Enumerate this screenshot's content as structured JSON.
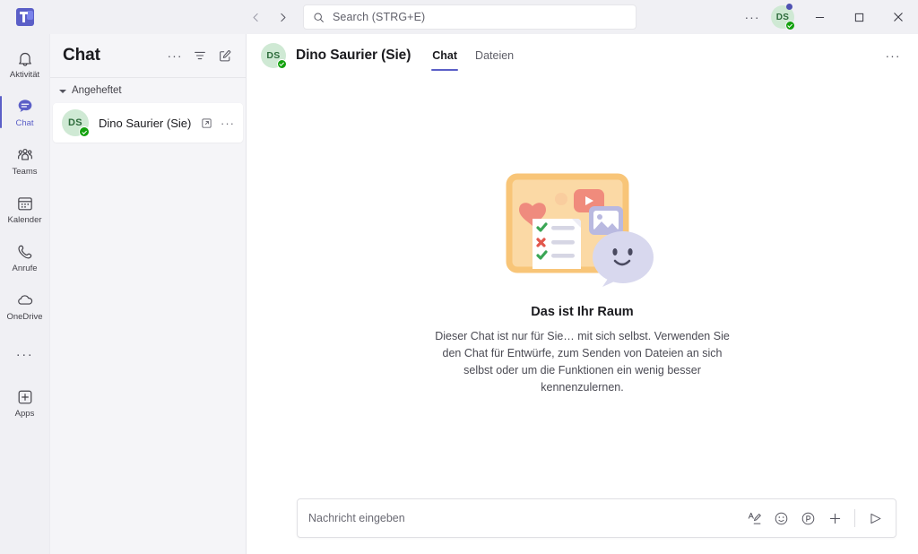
{
  "titlebar": {
    "logo_name": "teams-logo",
    "back_label": "‹",
    "forward_label": "›",
    "search_placeholder": "Search (STRG+E)",
    "more_label": "···",
    "avatar_initials": "DS",
    "minimize_label": "Minimieren",
    "maximize_label": "Maximieren",
    "close_label": "Schließen"
  },
  "rail": {
    "items": [
      {
        "label": "Aktivität",
        "icon": "bell-icon",
        "active": false
      },
      {
        "label": "Chat",
        "icon": "chat-bubble-icon",
        "active": true
      },
      {
        "label": "Teams",
        "icon": "people-icon",
        "active": false
      },
      {
        "label": "Kalender",
        "icon": "calendar-icon",
        "active": false
      },
      {
        "label": "Anrufe",
        "icon": "phone-icon",
        "active": false
      },
      {
        "label": "OneDrive",
        "icon": "cloud-icon",
        "active": false
      }
    ],
    "more_label": "···",
    "apps_label": "Apps"
  },
  "chatlist": {
    "title": "Chat",
    "more_label": "···",
    "filter_icon": "filter-icon",
    "compose_icon": "compose-icon",
    "section_label": "Angeheftet",
    "items": [
      {
        "name": "Dino Saurier (Sie)",
        "initials": "DS",
        "presence": "available",
        "popout_icon": "popout-icon",
        "more_label": "···"
      }
    ]
  },
  "chatheader": {
    "avatar_initials": "DS",
    "title": "Dino Saurier (Sie)",
    "tabs": [
      {
        "label": "Chat",
        "active": true
      },
      {
        "label": "Dateien",
        "active": false
      }
    ],
    "more_label": "···"
  },
  "empty_state": {
    "title": "Das ist Ihr Raum",
    "description": "Dieser Chat ist nur für Sie… mit sich selbst. Verwenden Sie den Chat für Entwürfe, zum Senden von Dateien an sich selbst oder um die Funktionen ein wenig besser kennenzulernen."
  },
  "composer": {
    "placeholder": "Nachricht eingeben",
    "actions": [
      {
        "name": "format-icon",
        "label": "Format"
      },
      {
        "name": "emoji-icon",
        "label": "Emoji"
      },
      {
        "name": "giphy-icon",
        "label": "Giphy"
      },
      {
        "name": "plus-icon",
        "label": "Mehr"
      },
      {
        "name": "send-icon",
        "label": "Senden"
      }
    ]
  },
  "colors": {
    "accent": "#5b5fc7",
    "presence_available": "#13a10e",
    "avatar_bg": "#cfe9d4",
    "avatar_fg": "#2d6b3b",
    "notification_dot": "#4f52b2",
    "illustration_board": "#fbd9a5",
    "illustration_board_border": "#f7bf72",
    "illustration_heart": "#ef8b7e",
    "illustration_bubble": "#d8d8ee"
  }
}
